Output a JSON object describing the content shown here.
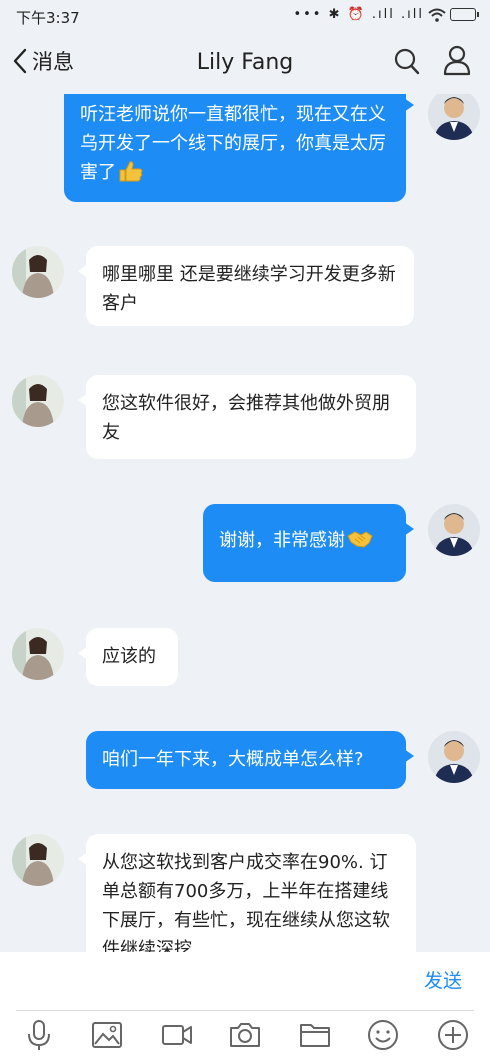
{
  "status_bar": {
    "time": "下午3:37",
    "icons": "••• ✱ ⏰ .ıll .ıll"
  },
  "header": {
    "back_label": "消息",
    "title": "Lily Fang"
  },
  "messages": [
    {
      "from": "me",
      "text": "听汪老师说你一直都很忙，现在又在义乌开发了一个线下的展厅，你真是太厉害了",
      "emoji": "thumbs-up"
    },
    {
      "from": "contact",
      "text": "哪里哪里 还是要继续学习开发更多新客户"
    },
    {
      "from": "contact",
      "text": "您这软件很好，会推荐其他做外贸朋友"
    },
    {
      "from": "me",
      "text": "谢谢，非常感谢",
      "emoji": "handshake"
    },
    {
      "from": "contact",
      "text": "应该的"
    },
    {
      "from": "me",
      "text": "咱们一年下来，大概成单怎么样?"
    },
    {
      "from": "contact",
      "text": "从您这软找到客户成交率在90%. 订单总额有700多万，上半年在搭建线下展厅，有些忙，现在继续从您这软件继续深挖"
    }
  ],
  "input": {
    "value": "",
    "placeholder": "",
    "send_label": "发送"
  },
  "toolbar": [
    "microphone-icon",
    "image-icon",
    "video-icon",
    "camera-icon",
    "folder-icon",
    "emoji-icon",
    "plus-icon"
  ],
  "colors": {
    "outgoing_bubble": "#1d8cf5",
    "incoming_bubble": "#ffffff",
    "background": "#eef1f5",
    "accent": "#1d8cf5"
  }
}
